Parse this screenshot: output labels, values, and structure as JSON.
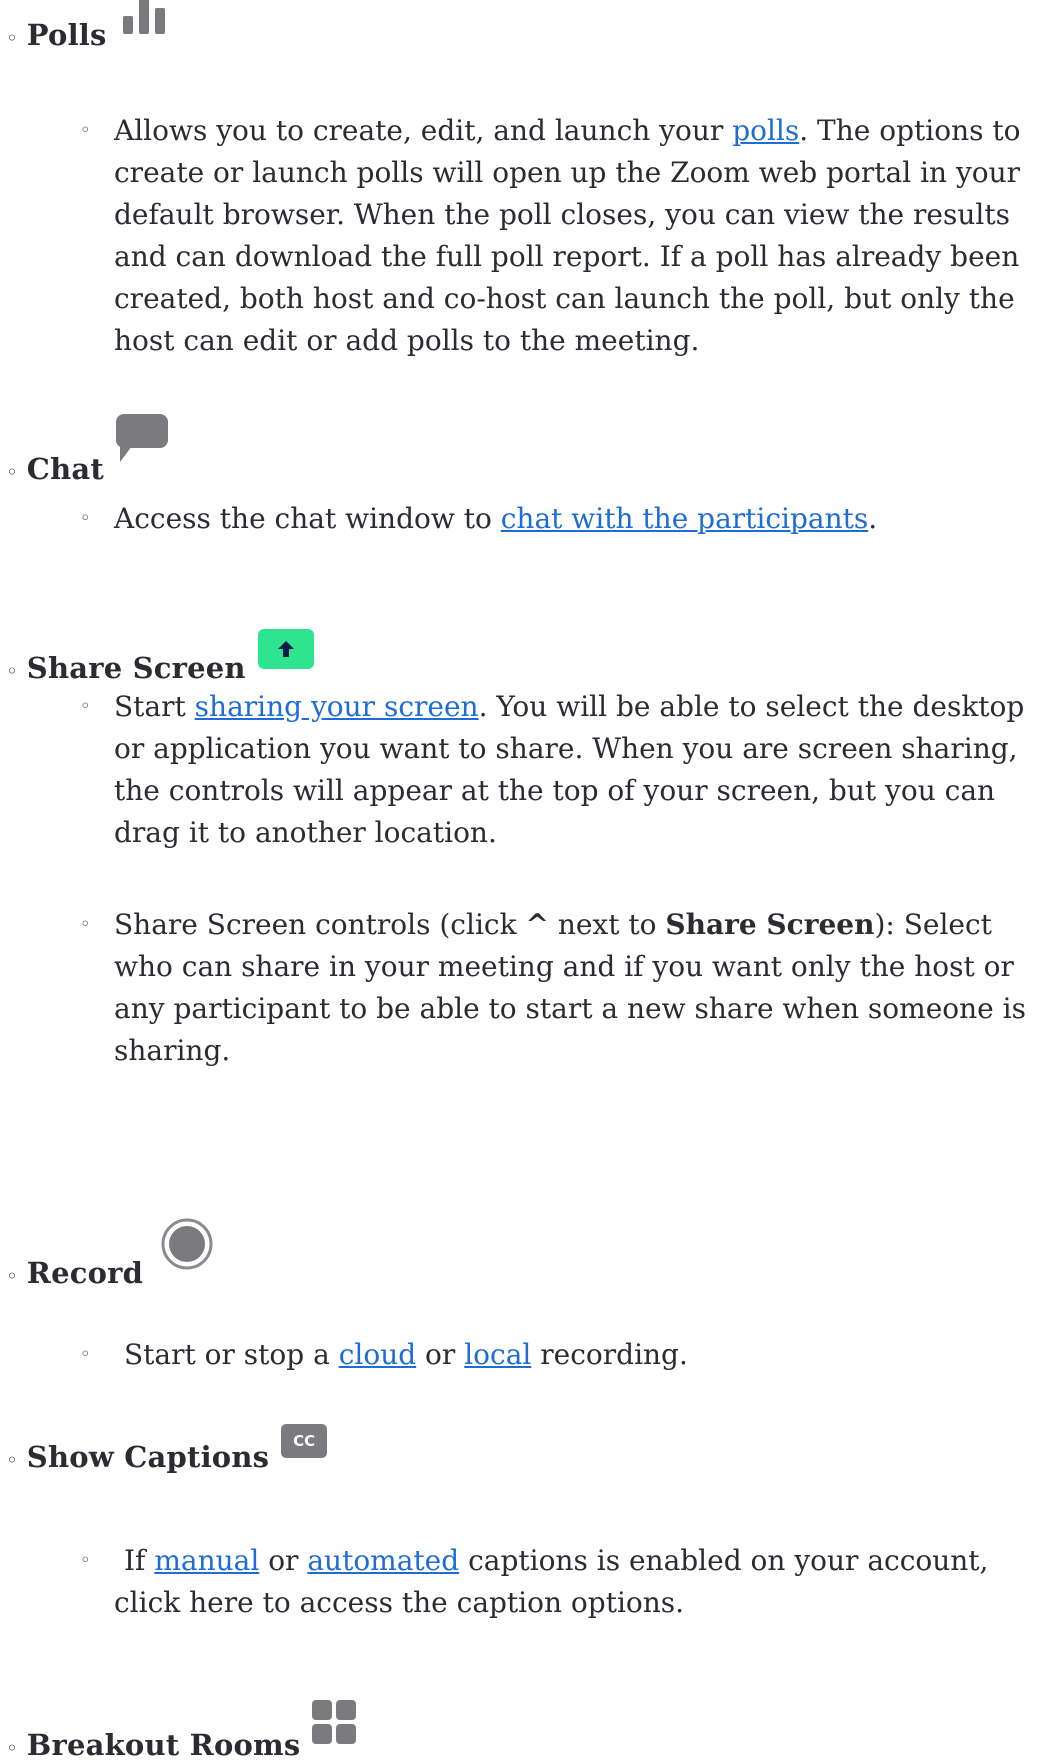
{
  "items": [
    {
      "title": "Polls",
      "icon": "bar-chart-icon",
      "paragraphs": [
        {
          "t0": "Allows you to create, edit, and launch your ",
          "link1": "polls",
          "t1": ". The options to create or launch polls will open up the Zoom web portal in your default browser. When the poll closes, you can view the results and can download the full poll report. If a poll has already been created, both host and co-host can launch the poll, but only the host can edit or add polls to the meeting."
        }
      ]
    },
    {
      "title": "Chat",
      "icon": "chat-bubble-icon",
      "paragraphs": [
        {
          "t0": "Access the chat window to ",
          "link1": "chat with the participants",
          "t1": "."
        }
      ]
    },
    {
      "title": "Share Screen",
      "icon": "share-screen-icon",
      "paragraphs": [
        {
          "t0": "Start ",
          "link1": "sharing your screen",
          "t1": ". You will be able to select the desktop or application you want to share. When you are screen sharing, the controls will appear at the top of your screen, but you can drag it to another location."
        },
        {
          "t0": "Share Screen controls (click ",
          "caret": "^",
          "t1": " next to ",
          "bold": "Share Screen",
          "t2": "): Select who can share in your meeting and if you want only the host or any participant to be able to start a new share when someone is sharing."
        }
      ]
    },
    {
      "title": "Record",
      "icon": "record-icon",
      "paragraphs": [
        {
          "t0": "Start or stop a ",
          "link1": "cloud",
          "t1": " or ",
          "link2": "local",
          "t2": " recording."
        }
      ]
    },
    {
      "title": "Show Captions",
      "icon": "cc-icon",
      "icon_text": "CC",
      "paragraphs": [
        {
          "t0": "If ",
          "link1": "manual",
          "t1": " or ",
          "link2": "automated",
          "t2": " captions is enabled on your account, click here to access the caption options."
        }
      ]
    },
    {
      "title": "Breakout Rooms",
      "icon": "breakout-rooms-icon",
      "paragraphs": []
    }
  ],
  "colors": {
    "link": "#1e6dd4",
    "text": "#2b2b33",
    "share_icon_bg": "#2ee48f",
    "icon_gray": "#7a7a7f"
  }
}
